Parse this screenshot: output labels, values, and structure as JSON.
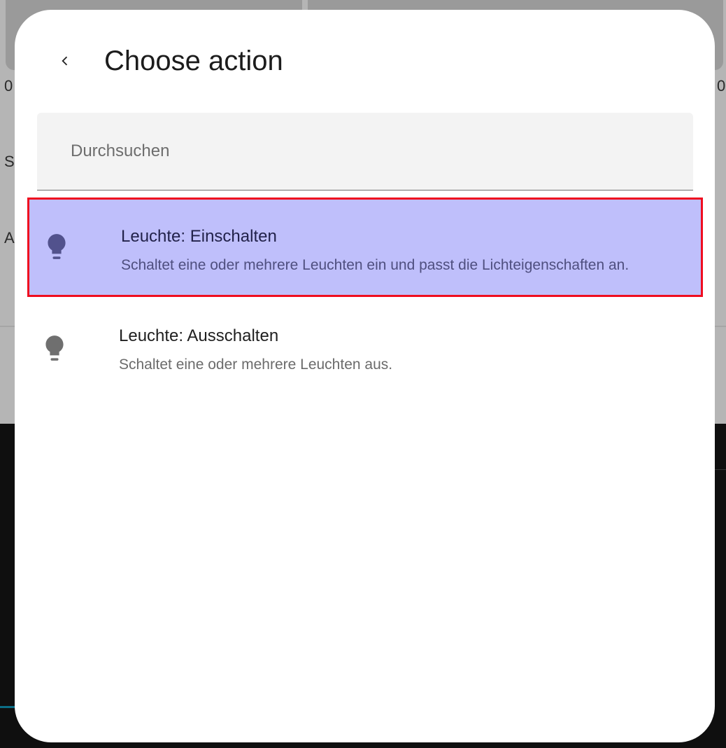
{
  "dialog": {
    "title": "Choose action",
    "back_icon": "chevron-left-icon"
  },
  "search": {
    "placeholder": "Durchsuchen",
    "value": ""
  },
  "actions": [
    {
      "title": "Leuchte: Einschalten",
      "description": "Schaltet eine oder mehrere Leuchten ein und passt die Lichteigenschaften an.",
      "icon": "lightbulb-icon",
      "selected": true
    },
    {
      "title": "Leuchte: Ausschalten",
      "description": "Schaltet eine oder mehrere Leuchten aus.",
      "icon": "lightbulb-icon",
      "selected": false
    }
  ],
  "background_glyphs": [
    "0",
    "S",
    "A",
    "0"
  ],
  "colors": {
    "selected_background": "#bfbffb",
    "selected_border": "#ef0d1f",
    "selected_icon": "#52528d",
    "icon": "#6f6f6f"
  }
}
